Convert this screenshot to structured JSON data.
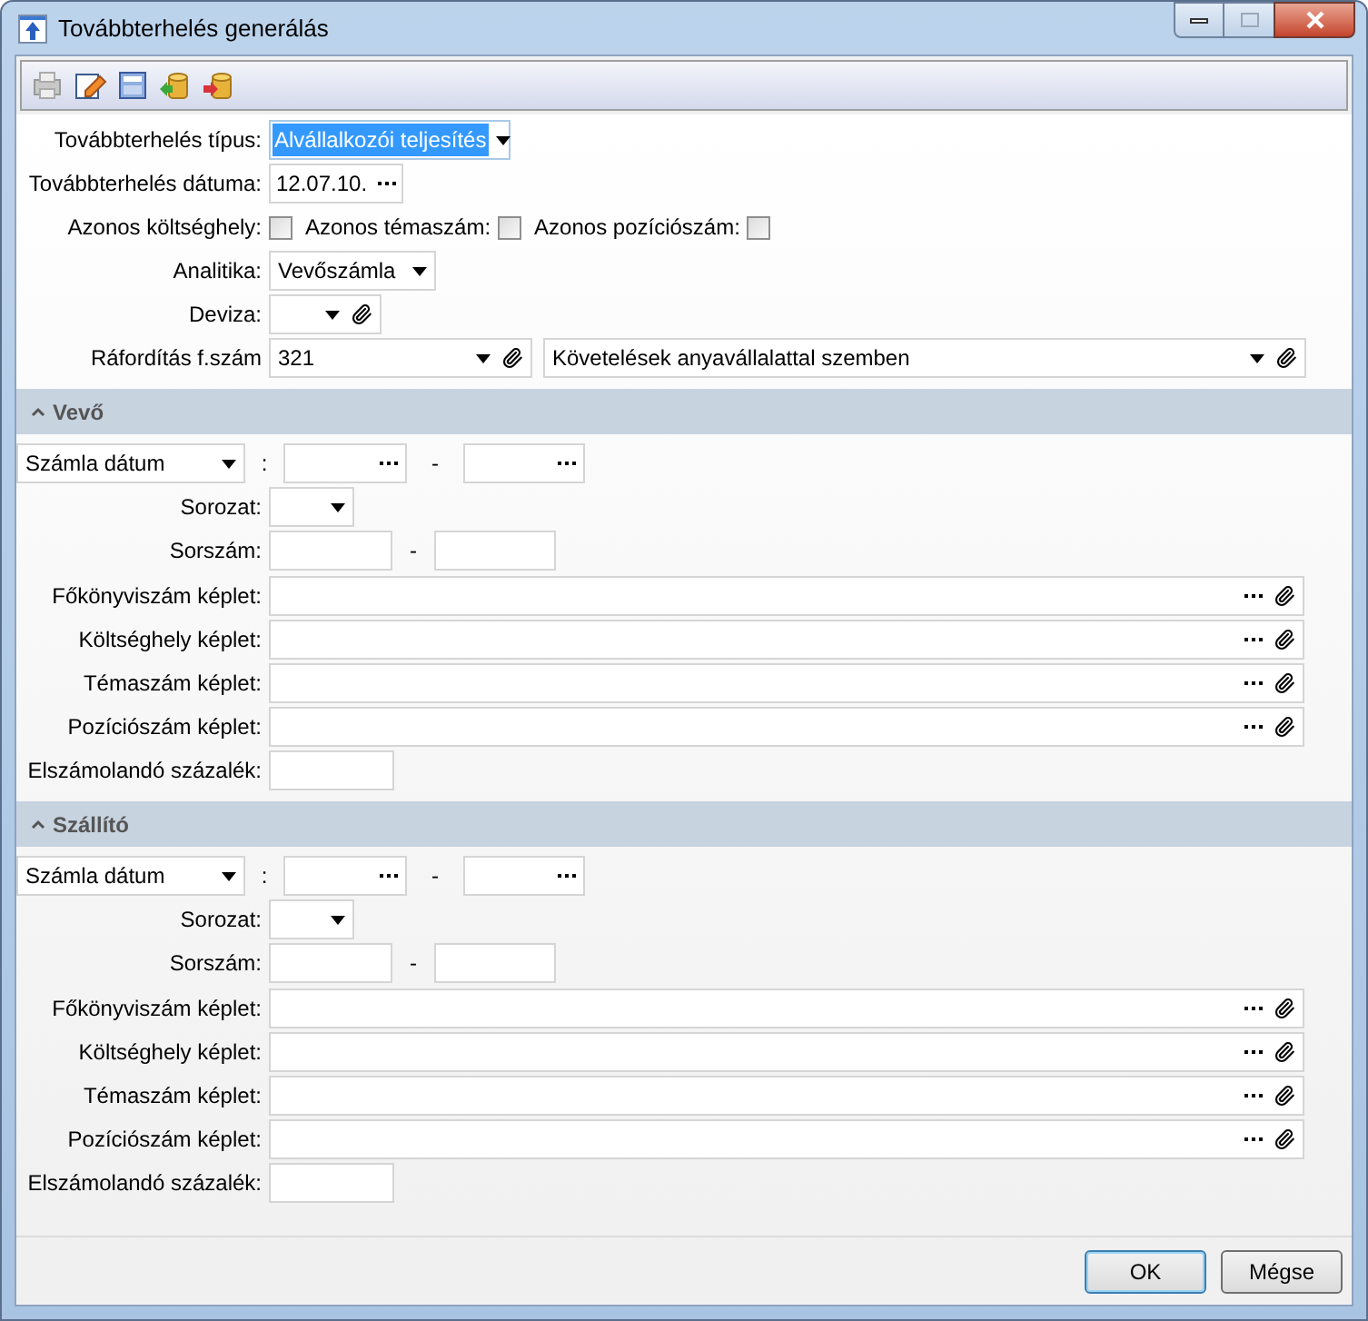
{
  "window": {
    "title": "Továbbterhelés generálás"
  },
  "form": {
    "type": {
      "label": "Továbbterhelés típus:",
      "value": "Alvállalkozói teljesítés",
      "highlighted": true
    },
    "date": {
      "label": "Továbbterhelés dátuma:",
      "value": "12.07.10."
    },
    "checks": [
      {
        "label": "Azonos költséghely:",
        "checked": false
      },
      {
        "label": "Azonos témaszám:",
        "checked": false
      },
      {
        "label": "Azonos pozíciószám:",
        "checked": false
      }
    ],
    "analytics": {
      "label": "Analitika:",
      "value": "Vevőszámla"
    },
    "currency": {
      "label": "Deviza:"
    },
    "account": {
      "label": "Ráfordítás f.szám",
      "value": "321",
      "description": "Követelések anyavállalattal szemben"
    }
  },
  "sections": [
    {
      "title": "Vevő",
      "expanded": true,
      "filter": "Számla dátum",
      "separator": ":",
      "date_dash": "-",
      "series_label": "Sorozat:",
      "number_label": "Sorszám:",
      "number_dash": "-",
      "formulas": [
        "Főkönyviszám képlet:",
        "Költséghely képlet:",
        "Témaszám képlet:",
        "Pozíciószám képlet:"
      ],
      "percent_label": "Elszámolandó százalék:"
    },
    {
      "title": "Szállító",
      "expanded": true,
      "filter": "Számla dátum",
      "separator": ":",
      "date_dash": "-",
      "series_label": "Sorozat:",
      "number_label": "Sorszám:",
      "number_dash": "-",
      "formulas": [
        "Főkönyviszám képlet:",
        "Költséghely képlet:",
        "Témaszám képlet:",
        "Pozíciószám képlet:"
      ],
      "percent_label": "Elszámolandó százalék:"
    }
  ],
  "buttons": [
    {
      "label": "OK",
      "default": true
    },
    {
      "label": "Mégse",
      "default": false
    }
  ]
}
